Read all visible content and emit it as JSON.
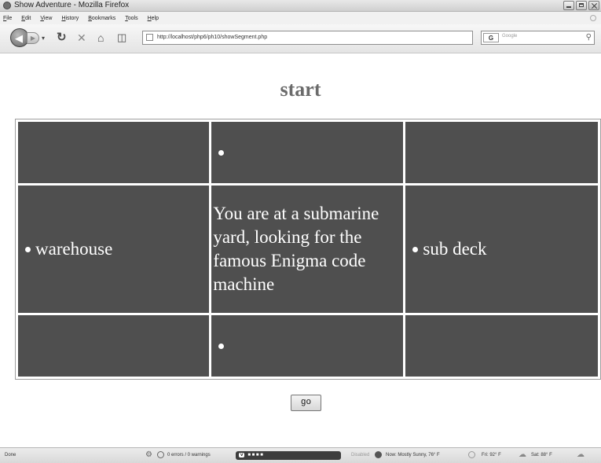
{
  "window": {
    "title": "Show Adventure - Mozilla Firefox"
  },
  "menu": {
    "items": [
      "File",
      "Edit",
      "View",
      "History",
      "Bookmarks",
      "Tools",
      "Help"
    ]
  },
  "toolbar": {
    "url": "http://localhost/php6/ph10/showSegment.php",
    "search_placeholder": "Google",
    "search_engine": "G"
  },
  "page": {
    "title": "start",
    "north": "",
    "west": "warehouse",
    "description": "You are at a submarine yard, looking for the famous Enigma code machine",
    "east": "sub deck",
    "south": "",
    "go_label": "go"
  },
  "status": {
    "text": "Done",
    "errors": "0 errors / 0 warnings",
    "disabled": "Disabled",
    "weather_now": "Now: Mostly Sunny, 76° F",
    "weather_fri": "Fri: 92° F",
    "weather_sat": "Sat: 88° F"
  },
  "colors": {
    "cell_bg": "#4f4f4f",
    "title_color": "#6b6b6b"
  }
}
